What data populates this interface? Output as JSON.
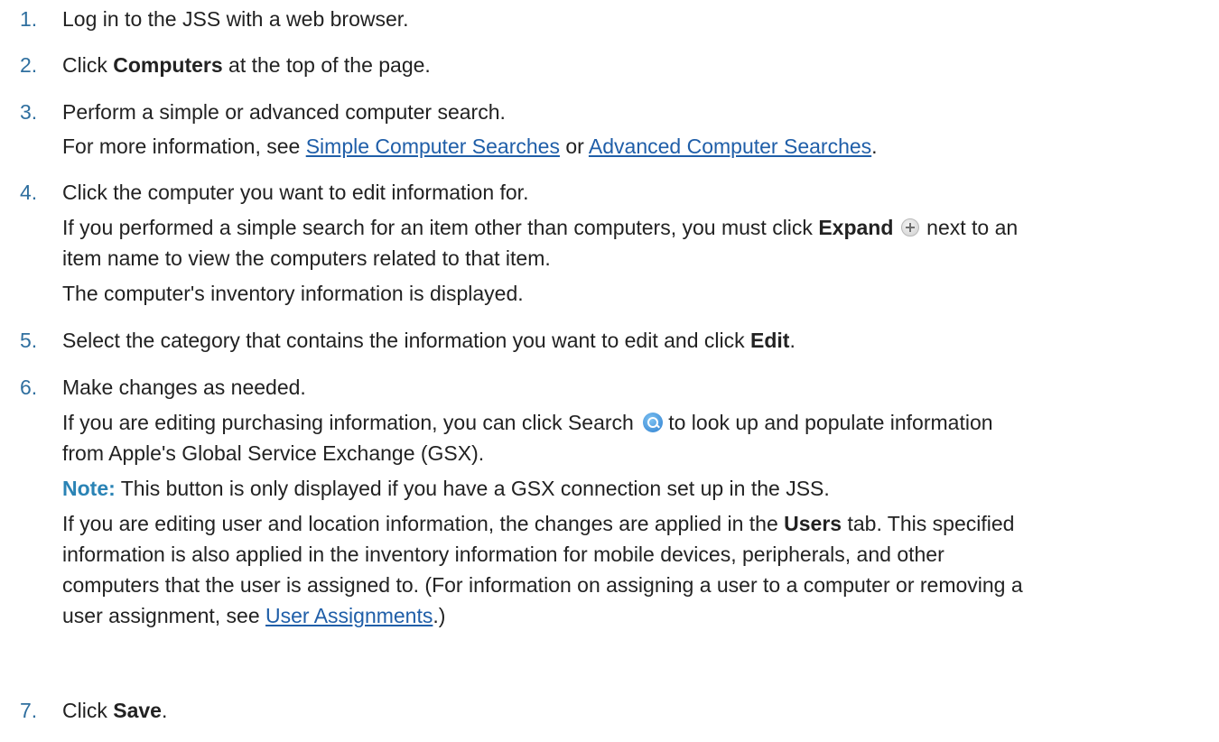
{
  "steps": [
    {
      "number": "1.",
      "text": "Log in to the JSS with a web browser."
    },
    {
      "number": "2.",
      "pre": "Click ",
      "bold": "Computers",
      "post": " at the top of the page."
    },
    {
      "number": "3.",
      "text": "Perform a simple or advanced computer search.",
      "sub_pre": "For more information, see ",
      "link1": "Simple Computer Searches",
      "sub_mid": " or ",
      "link2": "Advanced Computer Searches",
      "sub_post": "."
    },
    {
      "number": "4.",
      "text": "Click the computer you want to edit information for.",
      "sub1_pre": "If you performed a simple search for an item other than computers, you must click ",
      "sub1_bold": "Expand",
      "sub1_icon": "plus-circle-icon",
      "sub1_post": " next to an",
      "sub1_line2": "item name to view the computers related to that item.",
      "sub2": "The computer's inventory information is displayed."
    },
    {
      "number": "5.",
      "pre": "Select the category that contains the information you want to edit and click ",
      "bold": "Edit",
      "post": "."
    },
    {
      "number": "6.",
      "text": "Make changes as needed.",
      "sub1_pre": "If you are editing purchasing information, you can click Search",
      "sub1_icon": "search-icon",
      "sub1_post": "to look up and populate information",
      "sub1_line2": "from Apple's Global Service Exchange (GSX).",
      "note_label": "Note:",
      "note_text": " This button is only displayed if you have a GSX connection set up in the JSS.",
      "sub3_pre": "If you are editing user and location information, the changes are applied in the ",
      "sub3_bold": "Users",
      "sub3_post": " tab. This specified",
      "sub3_line2": "information is also applied in the inventory information for mobile devices, peripherals, and other",
      "sub3_line3": "computers that the user is assigned to. (For information on assigning a user to a computer or removing a",
      "sub3_line4_pre": "user assignment, see ",
      "sub3_link": "User Assignments",
      "sub3_line4_post": ".)"
    },
    {
      "number": "7.",
      "pre": "Click ",
      "bold": "Save",
      "post": "."
    }
  ],
  "colors": {
    "step_number": "#2f6f9f",
    "link": "#1f5ea8",
    "note_label": "#2a83b5",
    "text": "#222222"
  }
}
